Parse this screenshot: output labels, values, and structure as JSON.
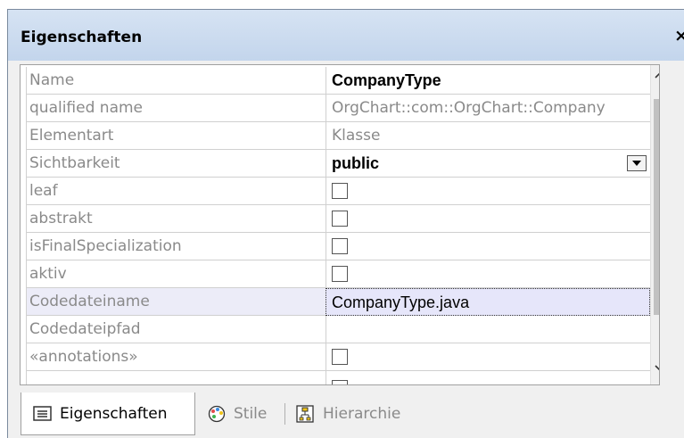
{
  "window": {
    "title": "Eigenschaften",
    "close_glyph": "×"
  },
  "properties": {
    "rows": [
      {
        "name": "Name",
        "value": "CompanyType",
        "type": "text-bold"
      },
      {
        "name": "qualified name",
        "value": "OrgChart::com::OrgChart::Company",
        "type": "text-gray"
      },
      {
        "name": "Elementart",
        "value": "Klasse",
        "type": "text-gray"
      },
      {
        "name": "Sichtbarkeit",
        "value": "public",
        "type": "dropdown"
      },
      {
        "name": "leaf",
        "value": "",
        "type": "checkbox"
      },
      {
        "name": "abstrakt",
        "value": "",
        "type": "checkbox"
      },
      {
        "name": "isFinalSpecialization",
        "value": "",
        "type": "checkbox"
      },
      {
        "name": "aktiv",
        "value": "",
        "type": "checkbox"
      },
      {
        "name": "Codedateiname",
        "value": "CompanyType.java",
        "type": "text-edit"
      },
      {
        "name": "Codedateipfad",
        "value": "",
        "type": "text"
      },
      {
        "name": "«annotations»",
        "value": "",
        "type": "checkbox"
      }
    ]
  },
  "tabs": [
    {
      "label": "Eigenschaften",
      "icon": "properties-icon",
      "active": true
    },
    {
      "label": "Stile",
      "icon": "palette-icon",
      "active": false
    },
    {
      "label": "Hierarchie",
      "icon": "hierarchy-icon",
      "active": false
    }
  ]
}
